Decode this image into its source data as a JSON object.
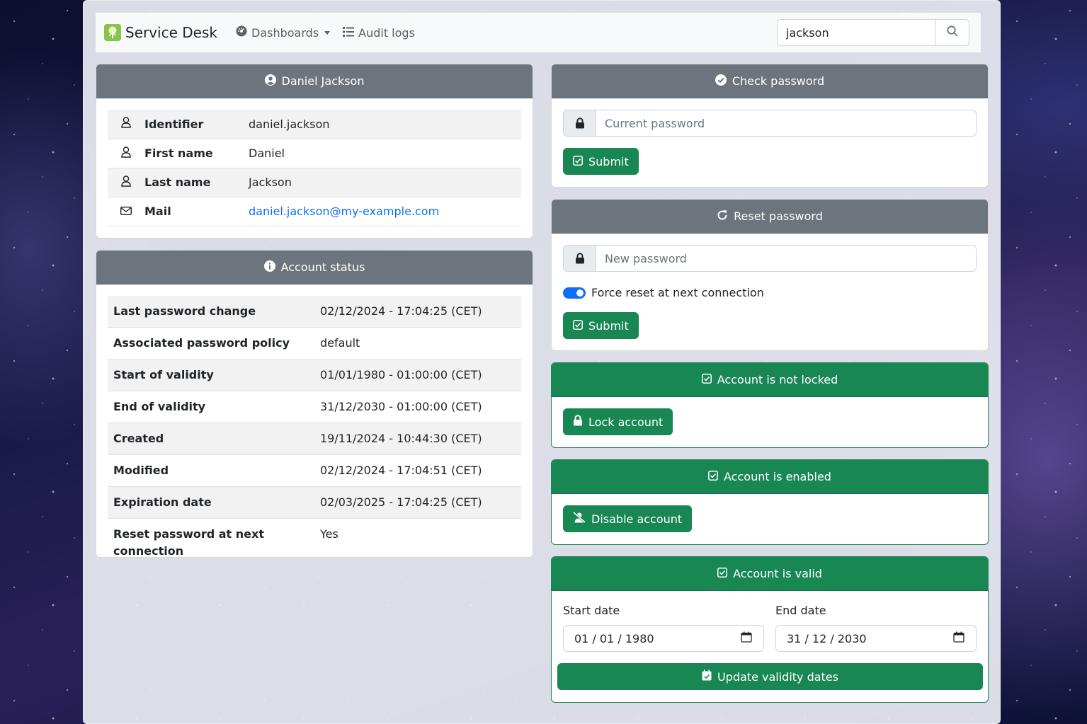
{
  "navbar": {
    "brand": "Service Desk",
    "dashboards_label": "Dashboards",
    "audit_logs_label": "Audit logs",
    "search_value": "jackson"
  },
  "user_card": {
    "title": "Daniel Jackson",
    "rows": [
      {
        "icon": "user-icon",
        "label": "Identifier",
        "value": "daniel.jackson"
      },
      {
        "icon": "user-icon",
        "label": "First name",
        "value": "Daniel"
      },
      {
        "icon": "user-icon",
        "label": "Last name",
        "value": "Jackson"
      },
      {
        "icon": "envelope-icon",
        "label": "Mail",
        "value": "daniel.jackson@my-example.com"
      }
    ]
  },
  "account_status": {
    "title": "Account status",
    "rows": [
      {
        "label": "Last password change",
        "value": "02/12/2024 - 17:04:25 (CET)"
      },
      {
        "label": "Associated password policy",
        "value": "default"
      },
      {
        "label": "Start of validity",
        "value": "01/01/1980 - 01:00:00 (CET)"
      },
      {
        "label": "End of validity",
        "value": "31/12/2030 - 01:00:00 (CET)"
      },
      {
        "label": "Created",
        "value": "19/11/2024 - 10:44:30 (CET)"
      },
      {
        "label": "Modified",
        "value": "02/12/2024 - 17:04:51 (CET)"
      },
      {
        "label": "Expiration date",
        "value": "02/03/2025 - 17:04:25 (CET)"
      },
      {
        "label": "Reset password at next connection",
        "value": "Yes"
      }
    ]
  },
  "check_password": {
    "title": "Check password",
    "placeholder": "Current password",
    "submit_label": "Submit"
  },
  "reset_password": {
    "title": "Reset password",
    "placeholder": "New password",
    "force_reset_label": "Force reset at next connection",
    "force_reset_checked": true,
    "submit_label": "Submit"
  },
  "lock_card": {
    "title": "Account is not locked",
    "button_label": "Lock account"
  },
  "enable_card": {
    "title": "Account is enabled",
    "button_label": "Disable account"
  },
  "validity_card": {
    "title": "Account is valid",
    "start_label": "Start date",
    "start_value": "01 / 01 / 1980",
    "end_label": "End date",
    "end_value": "31 / 12 / 2030",
    "button_label": "Update validity dates"
  },
  "colors": {
    "success": "#198754",
    "secondary": "#6c757d",
    "primary": "#0d6efd"
  }
}
